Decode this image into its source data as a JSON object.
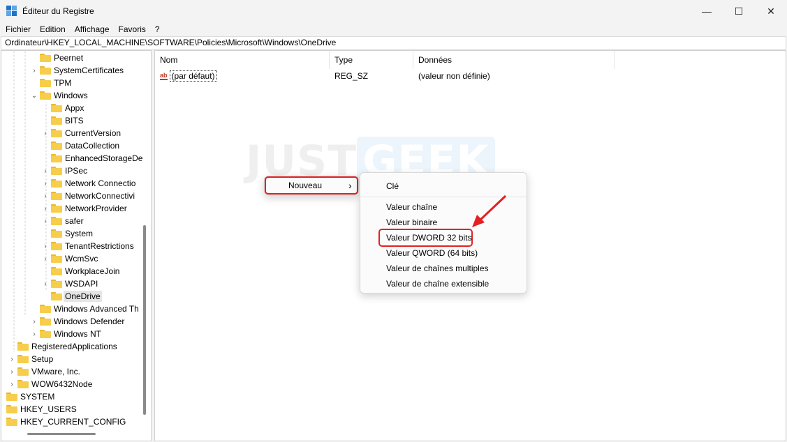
{
  "window": {
    "title": "Éditeur du Registre",
    "minimize": "—",
    "maximize": "☐",
    "close": "✕"
  },
  "menu": [
    "Fichier",
    "Edition",
    "Affichage",
    "Favoris",
    "?"
  ],
  "address": "Ordinateur\\HKEY_LOCAL_MACHINE\\SOFTWARE\\Policies\\Microsoft\\Windows\\OneDrive",
  "tree": [
    {
      "label": "Peernet",
      "chevron": ""
    },
    {
      "label": "SystemCertificates",
      "chevron": "›"
    },
    {
      "label": "TPM",
      "chevron": ""
    },
    {
      "label": "Windows",
      "chevron": "⌄"
    },
    {
      "label": "Appx",
      "chevron": ""
    },
    {
      "label": "BITS",
      "chevron": ""
    },
    {
      "label": "CurrentVersion",
      "chevron": "›"
    },
    {
      "label": "DataCollection",
      "chevron": ""
    },
    {
      "label": "EnhancedStorageDe",
      "chevron": ""
    },
    {
      "label": "IPSec",
      "chevron": "›"
    },
    {
      "label": "Network Connectio",
      "chevron": "›"
    },
    {
      "label": "NetworkConnectivi",
      "chevron": "›"
    },
    {
      "label": "NetworkProvider",
      "chevron": "›"
    },
    {
      "label": "safer",
      "chevron": "›"
    },
    {
      "label": "System",
      "chevron": ""
    },
    {
      "label": "TenantRestrictions",
      "chevron": "›"
    },
    {
      "label": "WcmSvc",
      "chevron": "›"
    },
    {
      "label": "WorkplaceJoin",
      "chevron": ""
    },
    {
      "label": "WSDAPI",
      "chevron": "›"
    },
    {
      "label": "OneDrive",
      "chevron": ""
    },
    {
      "label": "Windows Advanced Th",
      "chevron": ""
    },
    {
      "label": "Windows Defender",
      "chevron": "›"
    },
    {
      "label": "Windows NT",
      "chevron": "›"
    },
    {
      "label": "RegisteredApplications",
      "chevron": ""
    },
    {
      "label": "Setup",
      "chevron": "›"
    },
    {
      "label": "VMware, Inc.",
      "chevron": "›"
    },
    {
      "label": "WOW6432Node",
      "chevron": "›"
    },
    {
      "label": "SYSTEM",
      "chevron": "›"
    },
    {
      "label": "HKEY_USERS",
      "chevron": ""
    },
    {
      "label": "HKEY_CURRENT_CONFIG",
      "chevron": ""
    }
  ],
  "columns": [
    "Nom",
    "Type",
    "Données"
  ],
  "values": [
    {
      "icon": "ab",
      "name": "(par défaut)",
      "type": "REG_SZ",
      "data": "(valeur non définie)"
    }
  ],
  "watermark": {
    "part1": "JUST",
    "part2": "GEEK"
  },
  "context_menu": {
    "label": "Nouveau",
    "arrow": "›"
  },
  "submenu": {
    "key": "Clé",
    "items": [
      "Valeur chaîne",
      "Valeur binaire",
      "Valeur DWORD 32 bits",
      "Valeur QWORD (64 bits)",
      "Valeur de chaînes multiples",
      "Valeur de chaîne extensible"
    ]
  },
  "colors": {
    "highlight": "#e52020",
    "folder": "#f7cd4c"
  }
}
